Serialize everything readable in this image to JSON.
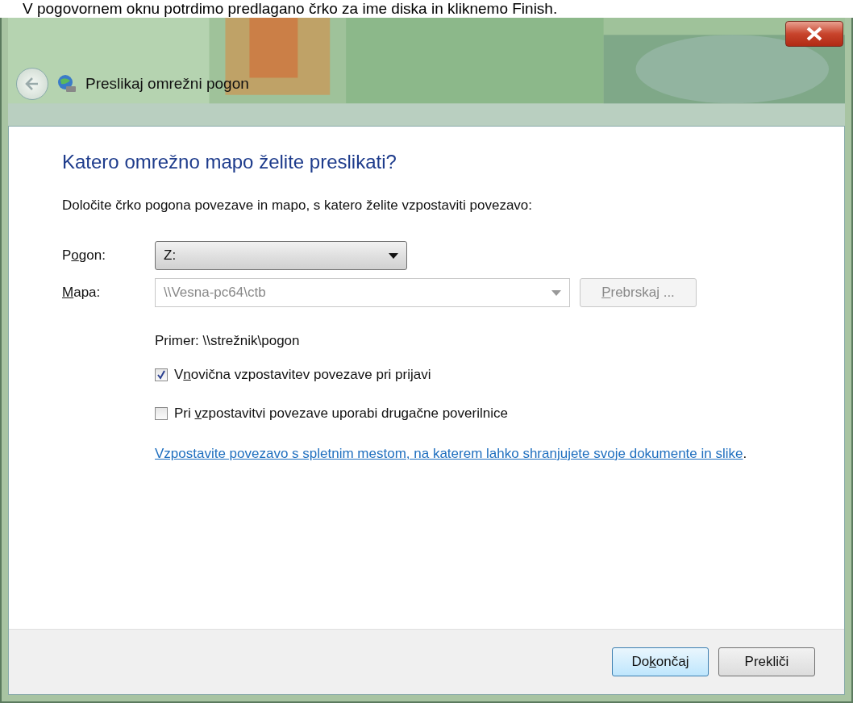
{
  "caption": "V pogovornem oknu potrdimo predlagano črko za ime diska in kliknemo Finish.",
  "window": {
    "title": "Preslikaj omrežni pogon"
  },
  "heading": "Katero omrežno mapo želite preslikati?",
  "instruction": "Določite črko pogona povezave in mapo, s katero želite vzpostaviti povezavo:",
  "fields": [
    {
      "label": {
        "before": "P",
        "key": "o",
        "after": "gon:"
      },
      "value": "Z:",
      "disabled": false
    },
    {
      "label": {
        "key": "M",
        "after": "apa:"
      },
      "value": "\\\\Vesna-pc64\\ctb",
      "disabled": true
    }
  ],
  "browse_button": {
    "key": "P",
    "after": "rebrskaj ...",
    "disabled": true
  },
  "example": "Primer: \\\\strežnik\\pogon",
  "checkboxes": [
    {
      "label": {
        "before": "V",
        "key": "n",
        "after": "ovična vzpostavitev povezave pri prijavi"
      },
      "checked": true
    },
    {
      "label": {
        "before": "Pri ",
        "key": "v",
        "after": "zpostavitvi povezave uporabi drugačne poverilnice"
      },
      "checked": false
    }
  ],
  "link": {
    "text": "Vzpostavite povezavo s spletnim mestom, na katerem lahko shranjujete svoje dokumente in slike",
    "after": "."
  },
  "buttons": [
    {
      "before": "Do",
      "key": "k",
      "after": "ončaj",
      "default": true
    },
    {
      "before": "Prekliči",
      "default": false
    }
  ]
}
